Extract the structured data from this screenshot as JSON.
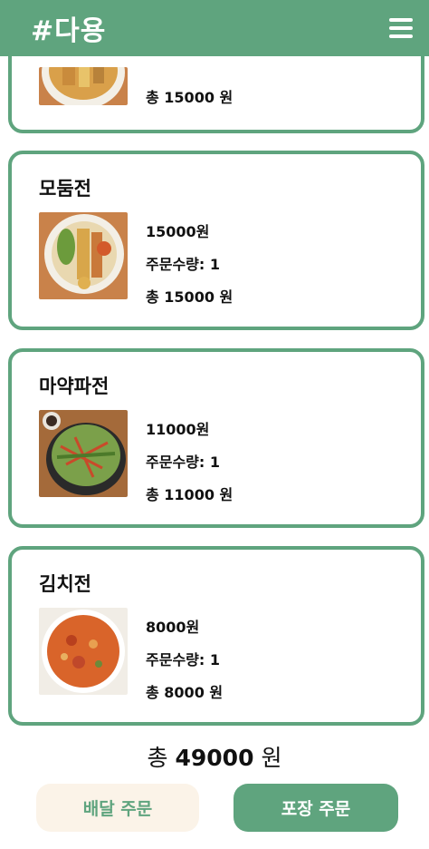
{
  "header": {
    "brand": "#다용",
    "menu_icon": "hamburger-icon"
  },
  "items": [
    {
      "name": "",
      "price": "",
      "quantity": "",
      "total": "총 15000 원"
    },
    {
      "name": "모둠전",
      "price": "15000원",
      "quantity": "주문수량: 1",
      "total": "총 15000 원"
    },
    {
      "name": "마약파전",
      "price": "11000원",
      "quantity": "주문수량: 1",
      "total": "총 11000 원"
    },
    {
      "name": "김치전",
      "price": "8000원",
      "quantity": "주문수량: 1",
      "total": "총 8000 원"
    }
  ],
  "summary": {
    "prefix": "총",
    "amount": "49000",
    "suffix": "원"
  },
  "buttons": {
    "delivery": "배달 주문",
    "takeout": "포장 주문"
  },
  "colors": {
    "accent": "#5fa47e",
    "delivery_bg": "#fbf3e8"
  }
}
